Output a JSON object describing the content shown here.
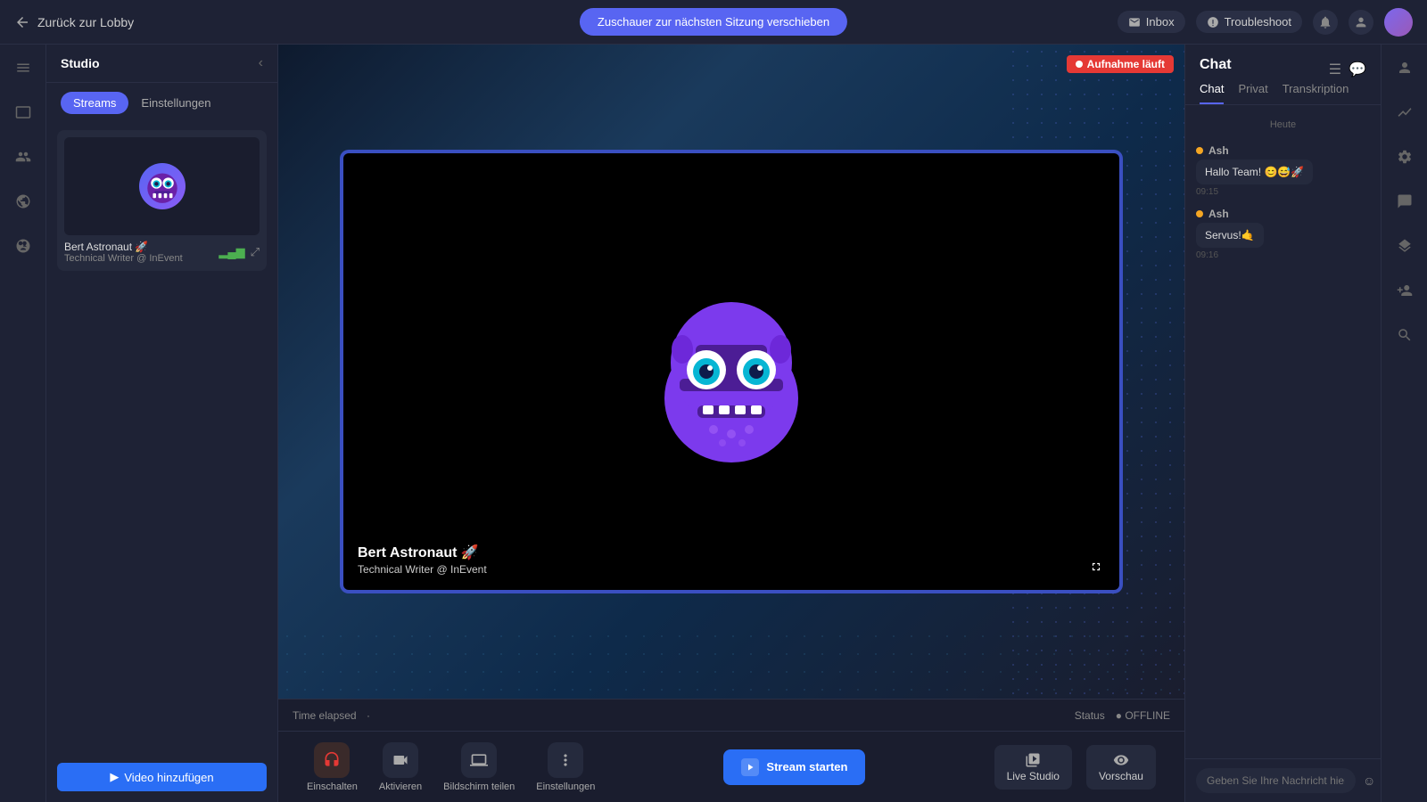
{
  "topbar": {
    "back_label": "Zurück zur Lobby",
    "center_btn_label": "Zuschauer zur nächsten Sitzung verschieben",
    "inbox_label": "Inbox",
    "troubleshoot_label": "Troubleshoot"
  },
  "studio": {
    "title": "Studio",
    "tabs": [
      "Streams",
      "Einstellungen"
    ],
    "active_tab": "Streams",
    "stream_item": {
      "name": "Bert Astronaut 🚀",
      "subtitle": "Technical Writer @ InEvent",
      "toggle_on": true
    },
    "add_video_label": "Video hinzufügen"
  },
  "video": {
    "recording_label": "Aufnahme läuft",
    "presenter_name": "Bert Astronaut 🚀",
    "presenter_subtitle": "Technical Writer @ InEvent"
  },
  "status_bar": {
    "time_elapsed_label": "Time elapsed",
    "time_value": "·",
    "status_label": "Status",
    "status_value": "● OFFLINE"
  },
  "controls": {
    "einschalten_label": "Einschalten",
    "aktivieren_label": "Aktivieren",
    "bildschirm_label": "Bildschirm teilen",
    "einstellungen_label": "Einstellungen",
    "stream_starten_label": "Stream starten",
    "live_studio_label": "Live Studio",
    "vorschau_label": "Vorschau"
  },
  "chat": {
    "title": "Chat",
    "tabs": [
      "Chat",
      "Privat",
      "Transkription"
    ],
    "active_tab": "Chat",
    "day_label": "Heute",
    "messages": [
      {
        "sender": "Ash",
        "bubble": "Hallo Team! 😊😅🚀",
        "time": "09:15"
      },
      {
        "sender": "Ash",
        "bubble": "Servus!🤙",
        "time": "09:16"
      }
    ],
    "input_placeholder": "Geben Sie Ihre Nachricht hier ein"
  }
}
